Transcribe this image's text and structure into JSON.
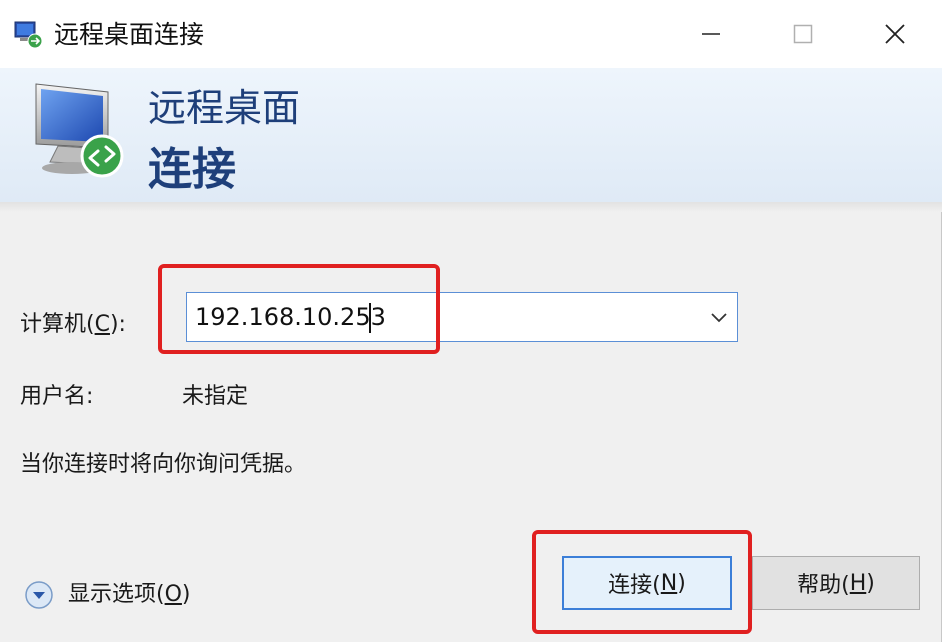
{
  "window": {
    "title": "远程桌面连接",
    "controls": {
      "minimize": "minimize-icon",
      "maximize": "maximize-icon",
      "close": "close-icon"
    }
  },
  "banner": {
    "line1": "远程桌面",
    "line2": "连接",
    "text_color": "#1e3f7a"
  },
  "form": {
    "computer_label": "计算机(",
    "computer_label_key": "C",
    "computer_label_end": "):",
    "computer_value": "192.168.10.253",
    "user_label": "用户名:",
    "user_value": "未指定",
    "hint": "当你连接时将向你询问凭据。"
  },
  "footer": {
    "options_label": "显示选项(",
    "options_key": "O",
    "options_end": ")",
    "connect_label": "连接(",
    "connect_key": "N",
    "connect_end": ")",
    "help_label": "帮助(",
    "help_key": "H",
    "help_end": ")"
  },
  "colors": {
    "highlight": "#e02020",
    "focus_border": "#3c7fd8",
    "dialog_background": "#f0f0f0"
  }
}
